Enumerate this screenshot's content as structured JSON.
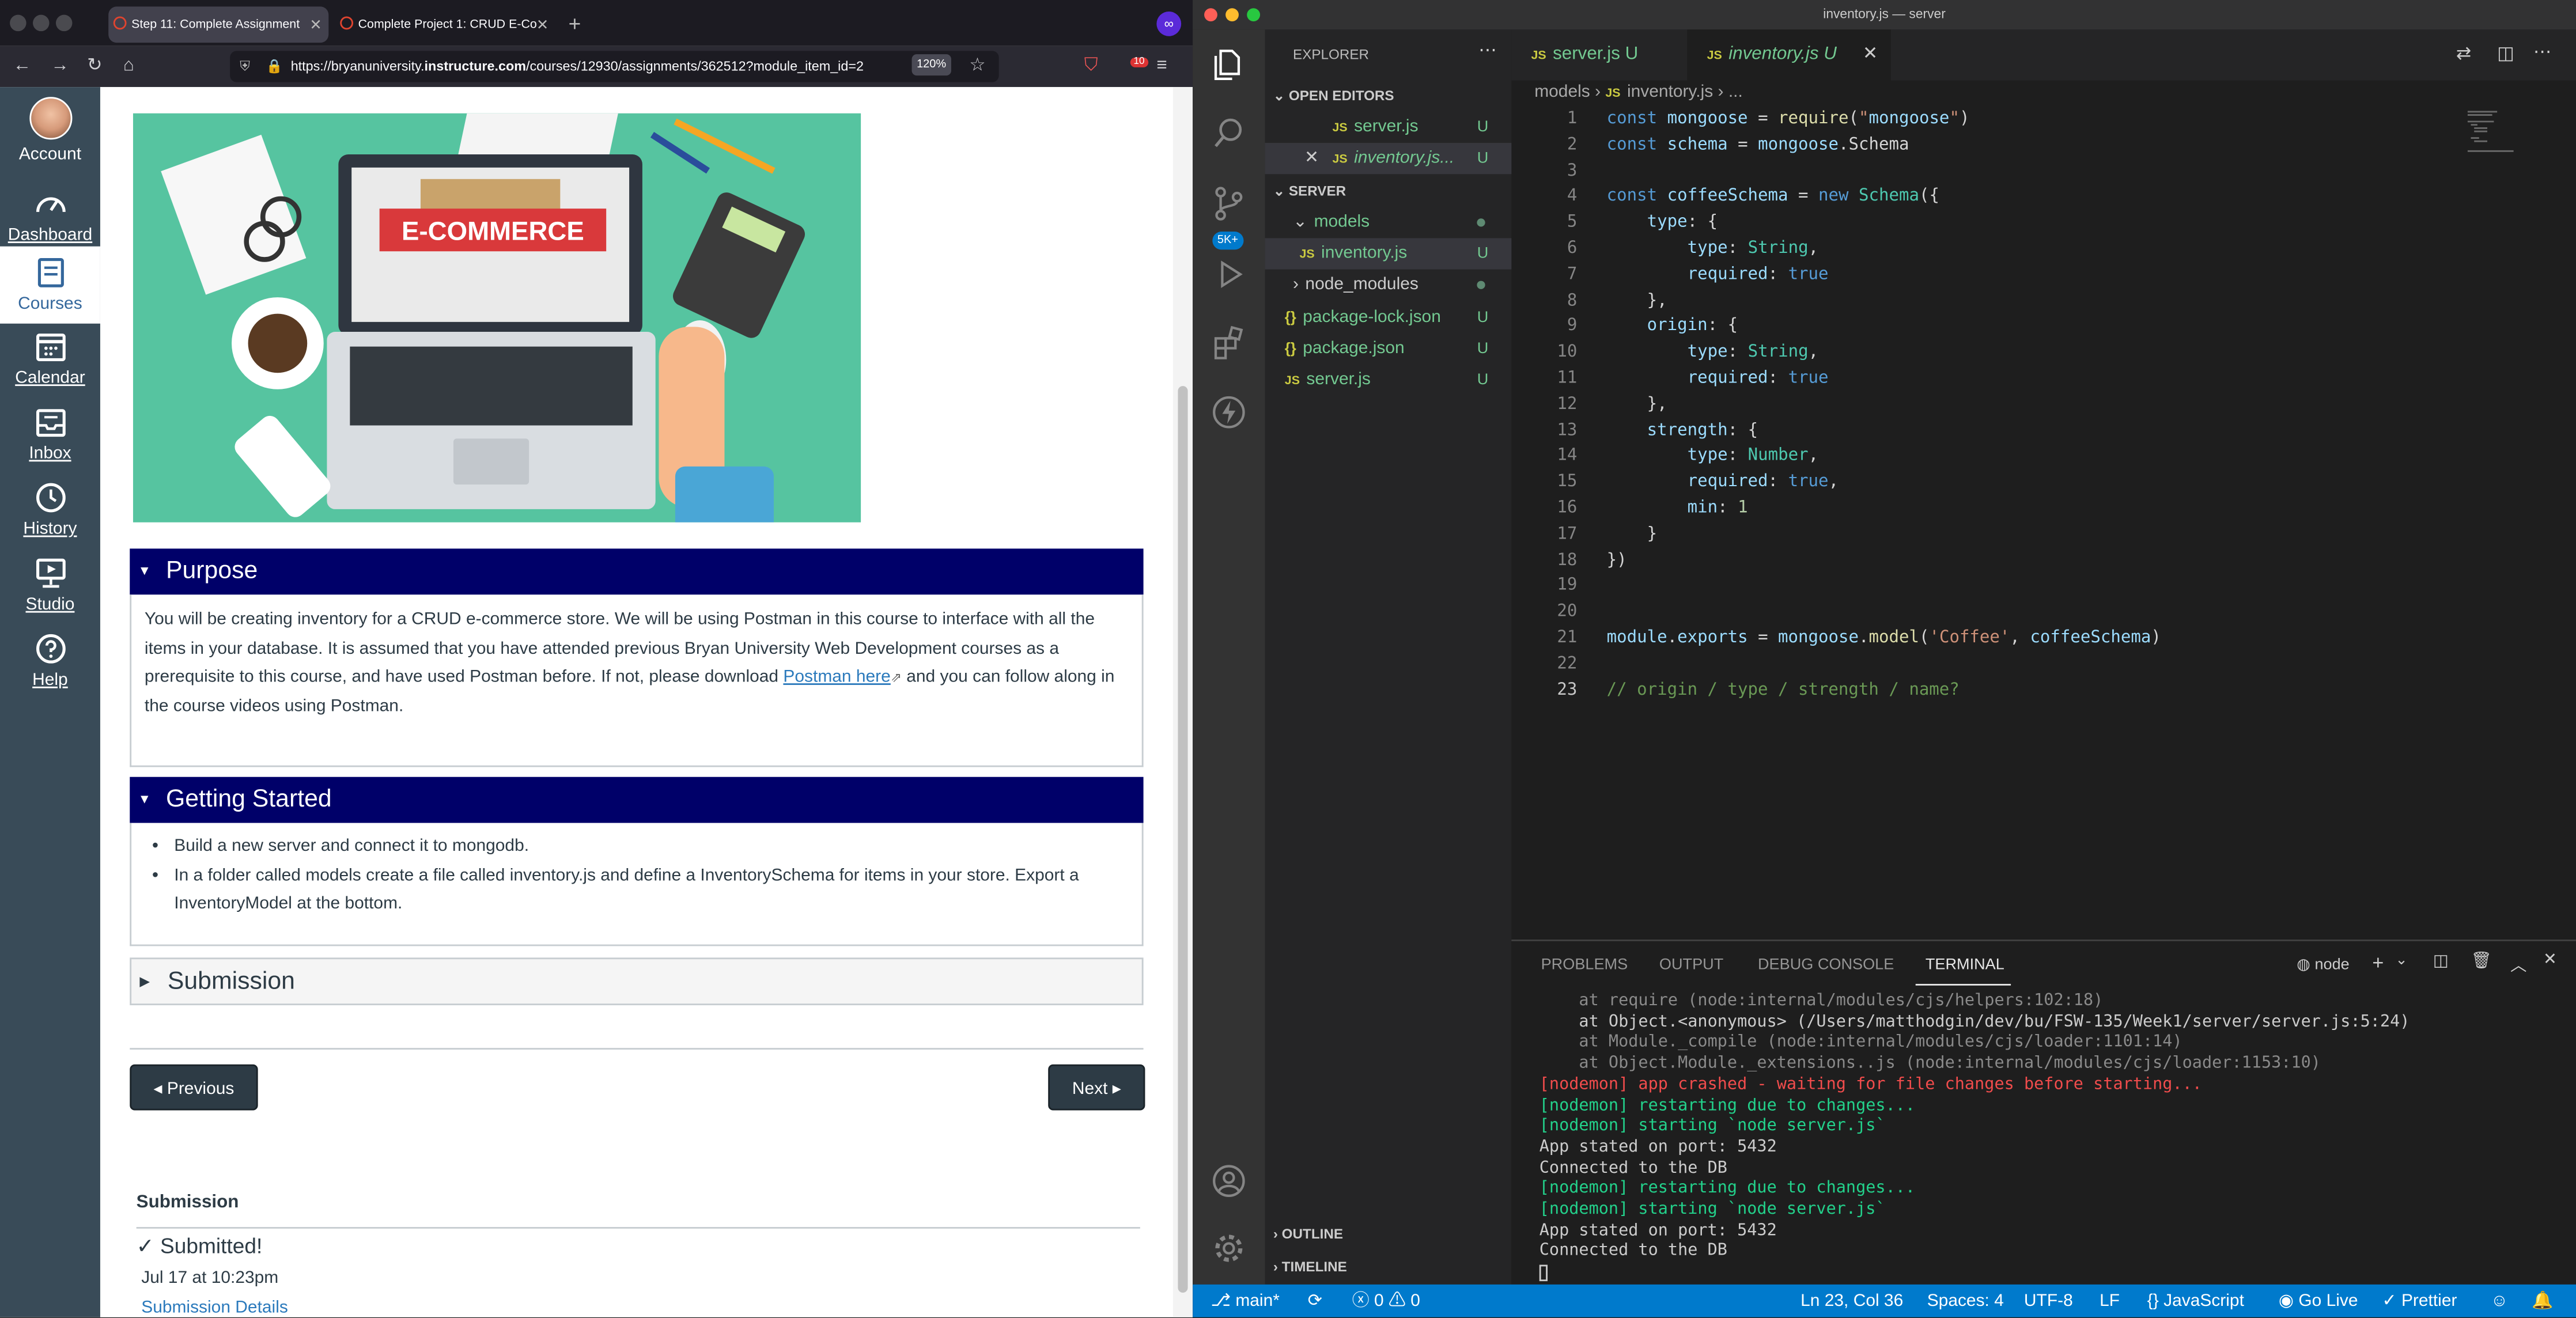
{
  "browser": {
    "tabs": [
      {
        "label": "Step 11: Complete Assignment",
        "active": true
      },
      {
        "label": "Complete Project 1: CRUD E-Co",
        "active": false
      }
    ],
    "url_prefix": "https://bryanuniversity.",
    "url_host": "instructure.com",
    "url_path": "/courses/12930/assignments/362512?module_item_id=2",
    "zoom": "120%",
    "notification_badge": "10"
  },
  "global_nav": [
    {
      "label": "Account",
      "icon": "avatar-icon"
    },
    {
      "label": "Dashboard",
      "icon": "dashboard-icon"
    },
    {
      "label": "Courses",
      "icon": "courses-icon",
      "selected": true
    },
    {
      "label": "Calendar",
      "icon": "calendar-icon"
    },
    {
      "label": "Inbox",
      "icon": "inbox-icon"
    },
    {
      "label": "History",
      "icon": "history-icon"
    },
    {
      "label": "Studio",
      "icon": "studio-icon"
    },
    {
      "label": "Help",
      "icon": "help-icon"
    }
  ],
  "hero": {
    "banner_text": "E-COMMERCE"
  },
  "purpose": {
    "heading": "Purpose",
    "text_before_link": "You will be creating inventory for a CRUD e-commerce store. We will be using Postman in this course to interface with all the items in your database. It is assumed that you have attended previous Bryan University Web Development courses as a prerequisite to this course, and have used Postman before. If not, please download ",
    "link": "Postman here",
    "text_after_link": " and you can follow along in the course videos using Postman."
  },
  "getting_started": {
    "heading": "Getting Started",
    "items": [
      "Build a new server and connect it to mongodb.",
      "In a folder called models create a file called inventory.js and define a InventorySchema for items in your store. Export a InventoryModel at the bottom."
    ]
  },
  "submission_accordion": {
    "heading": "Submission"
  },
  "pager": {
    "previous": "◂ Previous",
    "next": "Next ▸"
  },
  "submission": {
    "title": "Submission",
    "status": "Submitted!",
    "date": "Jul 17 at 10:23pm",
    "details_link": "Submission Details"
  },
  "vscode": {
    "window_title": "inventory.js — server",
    "explorer_title": "EXPLORER",
    "open_editors_label": "OPEN EDITORS",
    "open_editors": [
      {
        "name": "server.js",
        "status": "U"
      },
      {
        "name": "inventory.js...",
        "status": "U"
      }
    ],
    "server_label": "SERVER",
    "tree": [
      {
        "name": "models",
        "type": "folder"
      },
      {
        "name": "inventory.js",
        "type": "js",
        "status": "U"
      },
      {
        "name": "node_modules",
        "type": "folder"
      },
      {
        "name": "package-lock.json",
        "type": "json",
        "status": "U"
      },
      {
        "name": "package.json",
        "type": "json",
        "status": "U"
      },
      {
        "name": "server.js",
        "type": "js",
        "status": "U"
      }
    ],
    "outline_label": "OUTLINE",
    "timeline_label": "TIMELINE",
    "activity_badge": "5K+",
    "editor_tabs": [
      {
        "name": "server.js",
        "status": "U"
      },
      {
        "name": "inventory.js",
        "status": "U"
      }
    ],
    "breadcrumb": [
      "models",
      "inventory.js",
      "..."
    ],
    "code_lines": [
      "const mongoose = require(\"mongoose\")",
      "const schema = mongoose.Schema",
      "",
      "const coffeeSchema = new Schema({",
      "    type: {",
      "        type: String,",
      "        required: true",
      "    },",
      "    origin: {",
      "        type: String,",
      "        required: true",
      "    },",
      "    strength: {",
      "        type: Number,",
      "        required: true,",
      "        min: 1",
      "    }",
      "})",
      "",
      "",
      "module.exports = mongoose.model('Coffee', coffeeSchema)",
      "",
      "// origin / type / strength / name?"
    ],
    "panel_tabs": [
      "PROBLEMS",
      "OUTPUT",
      "DEBUG CONSOLE",
      "TERMINAL"
    ],
    "terminal_shell": "node",
    "terminal_lines": [
      "    at require (node:internal/modules/cjs/helpers:102:18)",
      "    at Object.<anonymous> (/Users/matthodgin/dev/bu/FSW-135/Week1/server/server.js:5:24)",
      "    at Module._compile (node:internal/modules/cjs/loader:1101:14)",
      "    at Object.Module._extensions..js (node:internal/modules/cjs/loader:1153:10)",
      "[nodemon] app crashed - waiting for file changes before starting...",
      "[nodemon] restarting due to changes...",
      "[nodemon] starting `node server.js`",
      "App stated on port: 5432",
      "Connected to the DB",
      "[nodemon] restarting due to changes...",
      "[nodemon] starting `node server.js`",
      "App stated on port: 5432",
      "Connected to the DB"
    ],
    "status": {
      "branch": "main*",
      "errors": "0",
      "warnings": "0",
      "cursor": "Ln 23, Col 36",
      "spaces": "Spaces: 4",
      "encoding": "UTF-8",
      "eol": "LF",
      "language": "JavaScript",
      "go_live": "Go Live",
      "prettier": "Prettier"
    }
  },
  "colors": {
    "canvas_nav": "#394b58",
    "accordion_header": "#000069",
    "vscode_statusbar": "#007acc",
    "git_untracked": "#73c991"
  }
}
